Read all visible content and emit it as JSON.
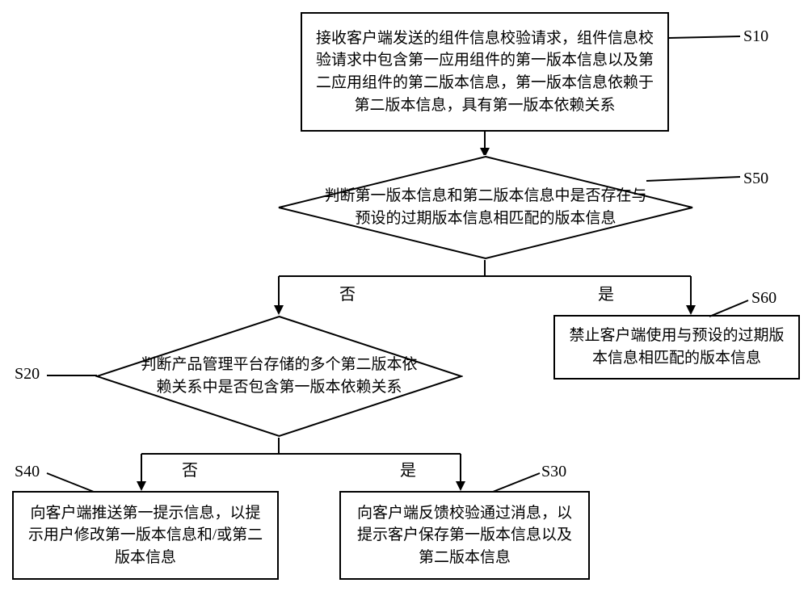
{
  "chart_data": {
    "type": "flowchart",
    "nodes": [
      {
        "id": "S10",
        "type": "process",
        "text": "接收客户端发送的组件信息校验请求，组件信息校验请求中包含第一应用组件的第一版本信息以及第二应用组件的第二版本信息，第一版本信息依赖于第二版本信息，具有第一版本依赖关系"
      },
      {
        "id": "S50",
        "type": "decision",
        "text": "判断第一版本信息和第二版本信息中是否存在与预设的过期版本信息相匹配的版本信息"
      },
      {
        "id": "S60",
        "type": "process",
        "text": "禁止客户端使用与预设的过期版本信息相匹配的版本信息"
      },
      {
        "id": "S20",
        "type": "decision",
        "text": "判断产品管理平台存储的多个第二版本依赖关系中是否包含第一版本依赖关系"
      },
      {
        "id": "S40",
        "type": "process",
        "text": "向客户端推送第一提示信息，以提示用户修改第一版本信息和/或第二版本信息"
      },
      {
        "id": "S30",
        "type": "process",
        "text": "向客户端反馈校验通过消息，以提示客户保存第一版本信息以及第二版本信息"
      }
    ],
    "edges": [
      {
        "from": "S10",
        "to": "S50",
        "label": ""
      },
      {
        "from": "S50",
        "to": "S20",
        "label": "否"
      },
      {
        "from": "S50",
        "to": "S60",
        "label": "是"
      },
      {
        "from": "S20",
        "to": "S40",
        "label": "否"
      },
      {
        "from": "S20",
        "to": "S30",
        "label": "是"
      }
    ],
    "labels": {
      "S10": "S10",
      "S50": "S50",
      "S60": "S60",
      "S20": "S20",
      "S40": "S40",
      "S30": "S30"
    },
    "edge_labels": {
      "no": "否",
      "yes": "是"
    }
  }
}
